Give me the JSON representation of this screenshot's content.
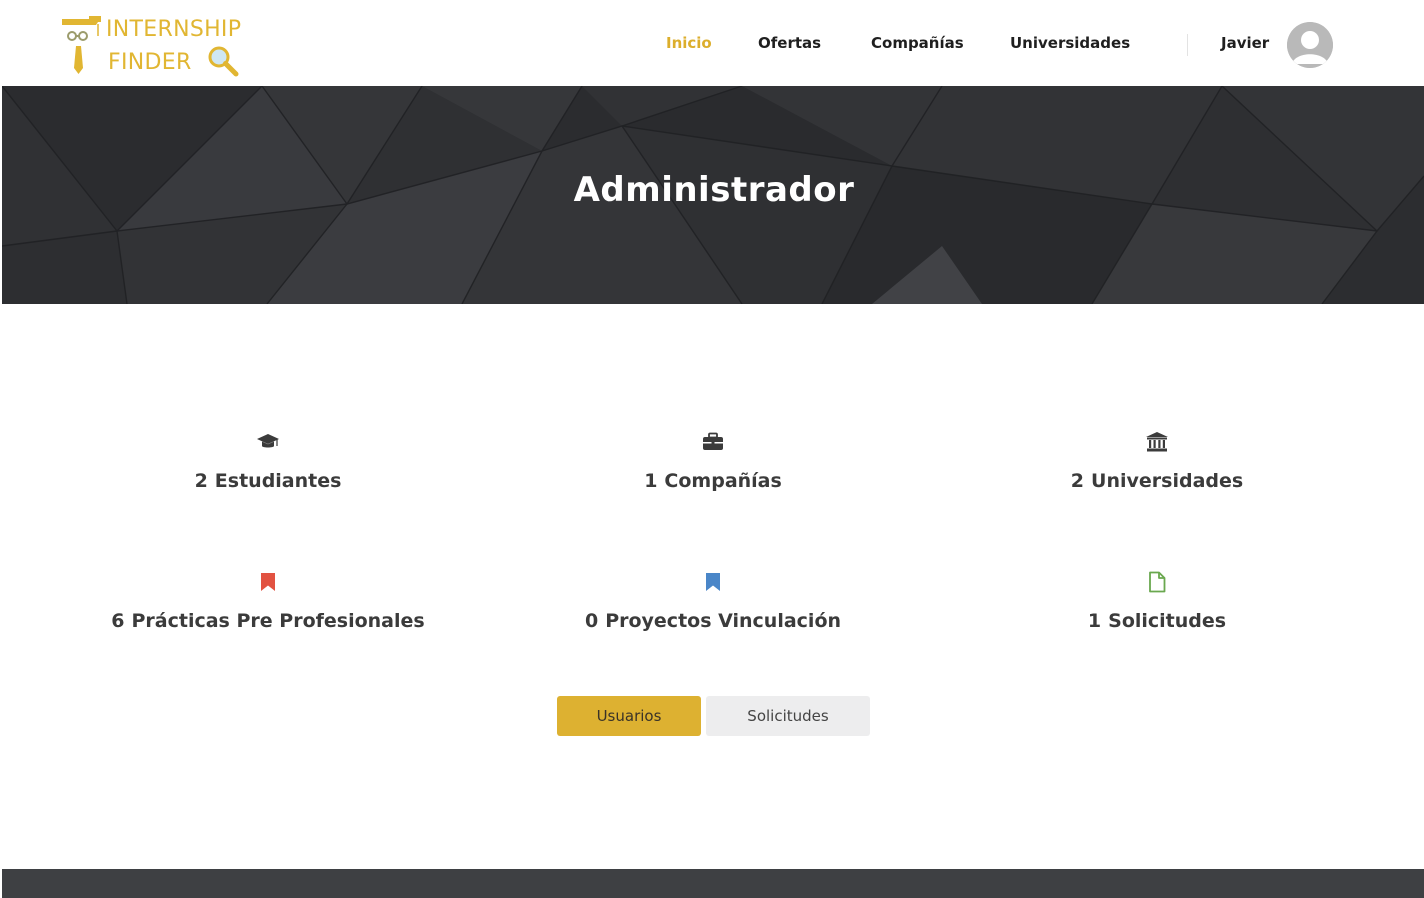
{
  "brand": {
    "line1": "INTERNSHIP",
    "line2": "FINDER",
    "color": "#e1b632"
  },
  "nav": {
    "items": [
      {
        "label": "Inicio",
        "active": true
      },
      {
        "label": "Ofertas",
        "active": false
      },
      {
        "label": "Compañías",
        "active": false
      },
      {
        "label": "Universidades",
        "active": false
      }
    ],
    "user_name": "Javier",
    "active_color": "#dcae2c"
  },
  "hero": {
    "title": "Administrador",
    "background": "#2c2d30"
  },
  "stats": [
    {
      "count": "2",
      "label": "Estudiantes",
      "icon": "graduation-cap-icon",
      "color": "#3b3b3b"
    },
    {
      "count": "1",
      "label": "Compañías",
      "icon": "briefcase-icon",
      "color": "#3b3b3b"
    },
    {
      "count": "2",
      "label": "Universidades",
      "icon": "university-icon",
      "color": "#3b3b3b"
    },
    {
      "count": "6",
      "label": "Prácticas Pre Profesionales",
      "icon": "bookmark-icon",
      "color": "#e25241"
    },
    {
      "count": "0",
      "label": "Proyectos Vinculación",
      "icon": "bookmark-icon",
      "color": "#4a86c8"
    },
    {
      "count": "1",
      "label": "Solicitudes",
      "icon": "file-icon",
      "color": "#6aa84f"
    }
  ],
  "actions": {
    "primary_label": "Usuarios",
    "secondary_label": "Solicitudes",
    "primary_color": "#ddb131"
  }
}
